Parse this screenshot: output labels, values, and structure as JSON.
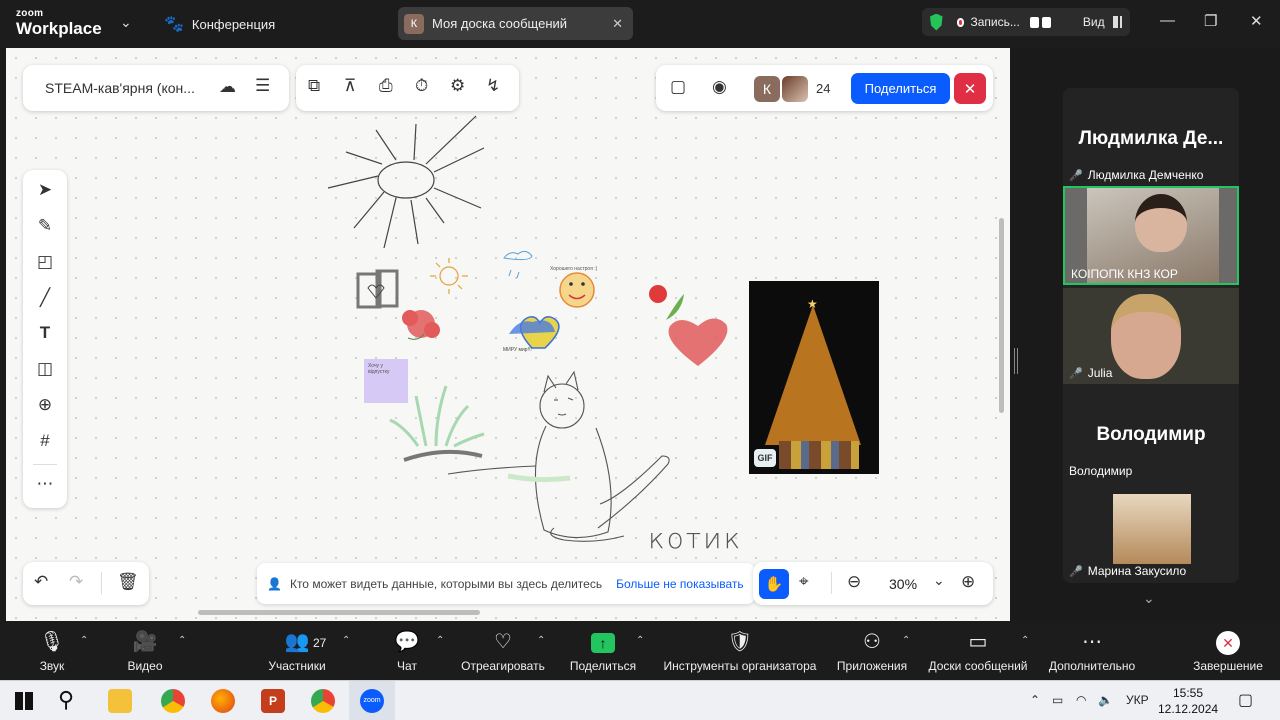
{
  "app": {
    "brand_top": "zoom",
    "brand_bottom": "Workplace",
    "conference_label": "Конференция"
  },
  "tab": {
    "avatar_letter": "К",
    "title": "Моя доска сообщений"
  },
  "recording": {
    "label": "Запись...",
    "view_label": "Вид"
  },
  "board": {
    "title": "STEAM-кав'ярня (кон...",
    "avatar_letter": "К",
    "viewer_count": "24",
    "share_label": "Поделиться",
    "notice_text": "Кто может видеть данные, которыми вы здесь делитесь",
    "notice_link": "Больше не показывать",
    "zoom_level": "30%",
    "canvas_texts": {
      "smile_caption": "Хорошего настроя :)",
      "heart_caption": "МИРУ мир!!!",
      "sticky_note": "Хочу у відпустку",
      "gif_badge": "GIF",
      "cat_caption": "котик"
    }
  },
  "participants": [
    {
      "big_name": "Людмилка  Де...",
      "label": "Людмилка Демченко",
      "muted": true
    },
    {
      "big_name": "",
      "label": "КОІПОПК КНЗ КОР",
      "muted": false
    },
    {
      "big_name": "",
      "label": "Julia",
      "muted": true
    },
    {
      "big_name": "Володимир",
      "label": "Володимир",
      "muted": false
    },
    {
      "big_name": "",
      "label": "Марина Закусило",
      "muted": true
    }
  ],
  "toolbar": {
    "audio": "Звук",
    "video": "Видео",
    "participants": "Участники",
    "participants_count": "27",
    "chat": "Чат",
    "react": "Отреагировать",
    "share": "Поделиться",
    "host_tools": "Инструменты организатора",
    "apps": "Приложения",
    "whiteboards": "Доски сообщений",
    "more": "Дополнительно",
    "end": "Завершение"
  },
  "taskbar": {
    "lang": "УКР",
    "time": "15:55",
    "date": "12.12.2024"
  },
  "colors": {
    "accent": "#0b5cff",
    "danger": "#e02e45",
    "active_border": "#22c55e"
  }
}
